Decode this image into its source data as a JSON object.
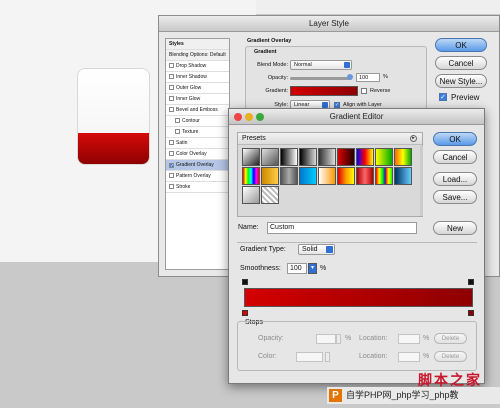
{
  "layer_style": {
    "title": "Layer Style",
    "styles_panel": {
      "header": "Styles",
      "blending": "Blending Options: Default",
      "items": [
        {
          "label": "Drop Shadow",
          "checked": false,
          "indent": false
        },
        {
          "label": "Inner Shadow",
          "checked": false,
          "indent": false
        },
        {
          "label": "Outer Glow",
          "checked": false,
          "indent": false
        },
        {
          "label": "Inner Glow",
          "checked": false,
          "indent": false
        },
        {
          "label": "Bevel and Emboss",
          "checked": false,
          "indent": false
        },
        {
          "label": "Contour",
          "checked": false,
          "indent": true
        },
        {
          "label": "Texture",
          "checked": false,
          "indent": true
        },
        {
          "label": "Satin",
          "checked": false,
          "indent": false
        },
        {
          "label": "Color Overlay",
          "checked": false,
          "indent": false
        },
        {
          "label": "Gradient Overlay",
          "checked": true,
          "indent": false,
          "selected": true
        },
        {
          "label": "Pattern Overlay",
          "checked": false,
          "indent": false
        },
        {
          "label": "Stroke",
          "checked": false,
          "indent": false
        }
      ]
    },
    "section_title": "Gradient Overlay",
    "group_title": "Gradient",
    "blend_mode_label": "Blend Mode:",
    "blend_mode_value": "Normal",
    "opacity_label": "Opacity:",
    "opacity_value": "100",
    "opacity_unit": "%",
    "gradient_label": "Gradient:",
    "reverse_label": "Reverse",
    "style_label": "Style:",
    "style_value": "Linear",
    "align_label": "Align with Layer",
    "buttons": {
      "ok": "OK",
      "cancel": "Cancel",
      "new_style": "New Style..."
    },
    "preview_label": "Preview",
    "preview_checked": true
  },
  "gradient_editor": {
    "title": "Gradient Editor",
    "presets_label": "Presets",
    "menu_glyph": "▸",
    "buttons": {
      "ok": "OK",
      "cancel": "Cancel",
      "load": "Load...",
      "save": "Save...",
      "new": "New"
    },
    "name_label": "Name:",
    "name_value": "Custom",
    "gradient_type_label": "Gradient Type:",
    "gradient_type_value": "Solid",
    "smoothness_label": "Smoothness:",
    "smoothness_value": "100",
    "smoothness_unit": "%",
    "gradient_start_color": "#d40000",
    "gradient_end_color": "#8e0000",
    "stops": {
      "group_title": "Stops",
      "opacity_label": "Opacity:",
      "color_label": "Color:",
      "location_label": "Location:",
      "percent": "%",
      "delete_label": "Delete"
    }
  },
  "watermark": {
    "script_text": "脚本之家",
    "logo": "P",
    "text": "自学PHP网_php学习_php教"
  }
}
